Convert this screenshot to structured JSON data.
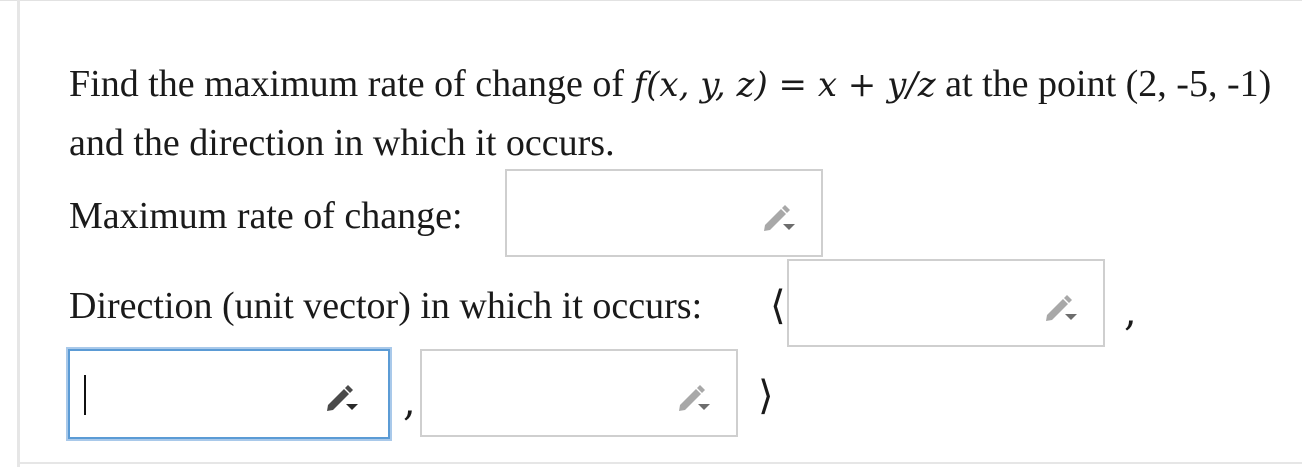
{
  "question": {
    "text_before": "Find the maximum rate of change of ",
    "function_expr": "f(x, y, z)",
    "equals": " = ",
    "function_body": "x + y/z",
    "text_mid": " at the point (2, -5, -1) and the direction in which it occurs."
  },
  "max_rate": {
    "label": "Maximum rate of change:",
    "value": ""
  },
  "direction": {
    "label": "Direction (unit vector) in which it occurs:",
    "open_bracket": "⟨",
    "separator_1": ",",
    "separator_2": ",",
    "close_bracket": "⟩",
    "components": [
      "",
      "",
      ""
    ]
  },
  "icons": {
    "edit": "pencil-dropdown-icon"
  },
  "colors": {
    "active_border": "#5b9bd5",
    "field_border": "#cfcfcf",
    "icon_gray": "#8a8a8a"
  }
}
